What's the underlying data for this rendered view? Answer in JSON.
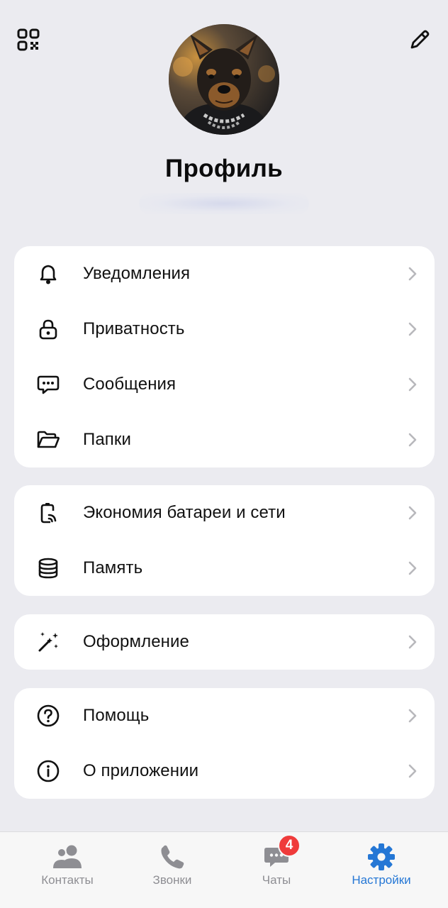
{
  "header": {
    "title": "Профиль"
  },
  "sections": [
    {
      "items": [
        {
          "label": "Уведомления",
          "icon": "bell-icon"
        },
        {
          "label": "Приватность",
          "icon": "lock-icon"
        },
        {
          "label": "Сообщения",
          "icon": "message-icon"
        },
        {
          "label": "Папки",
          "icon": "folder-icon"
        }
      ]
    },
    {
      "items": [
        {
          "label": "Экономия батареи и сети",
          "icon": "battery-network-icon"
        },
        {
          "label": "Память",
          "icon": "storage-icon"
        }
      ]
    },
    {
      "items": [
        {
          "label": "Оформление",
          "icon": "magic-wand-icon"
        }
      ]
    },
    {
      "items": [
        {
          "label": "Помощь",
          "icon": "help-icon"
        },
        {
          "label": "О приложении",
          "icon": "info-icon"
        }
      ]
    }
  ],
  "tabbar": {
    "tabs": [
      {
        "label": "Контакты",
        "icon": "contacts-icon"
      },
      {
        "label": "Звонки",
        "icon": "phone-icon"
      },
      {
        "label": "Чаты",
        "icon": "chat-icon",
        "badge": "4"
      },
      {
        "label": "Настройки",
        "icon": "gear-icon"
      }
    ],
    "active_tab": "Настройки"
  },
  "colors": {
    "background": "#ebebf0",
    "card": "#ffffff",
    "accent": "#2577d5",
    "badge": "#ef3b3b",
    "inactive_tab": "#8e8e93"
  }
}
